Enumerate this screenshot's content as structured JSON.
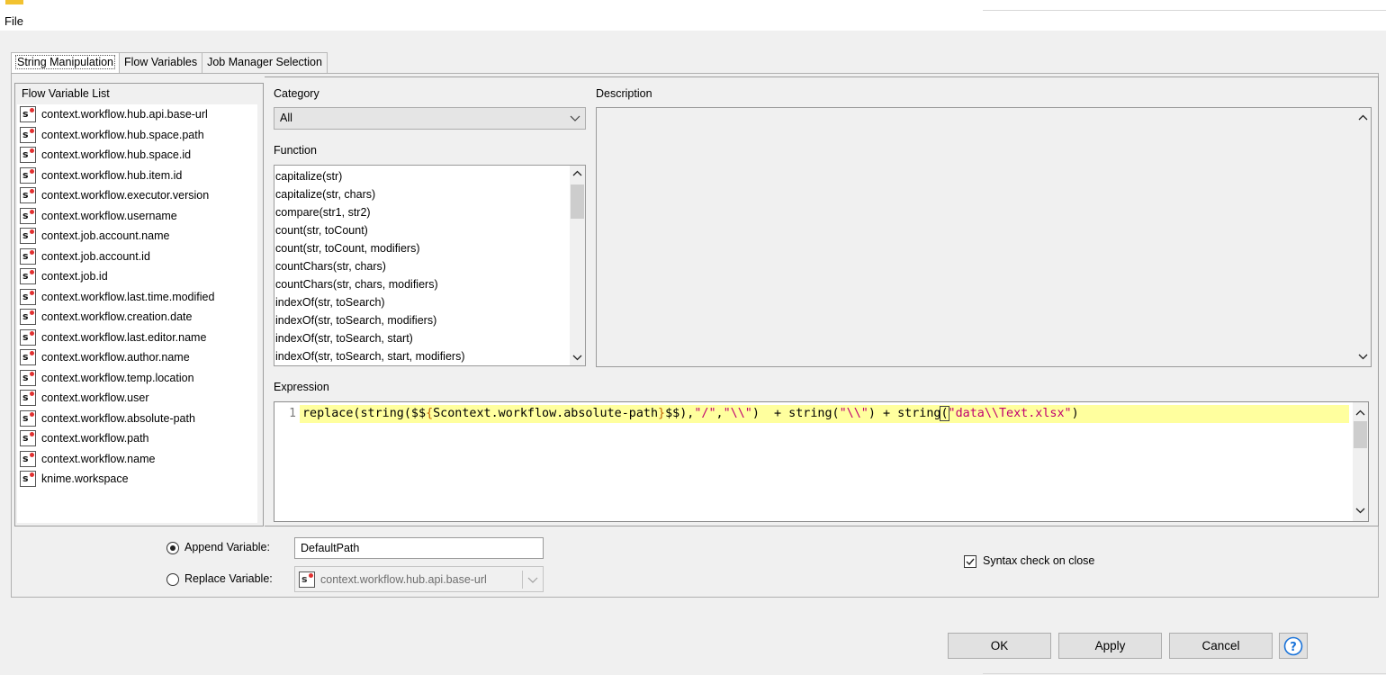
{
  "menu": {
    "file": "File"
  },
  "tabs": [
    {
      "label": "String Manipulation",
      "active": true
    },
    {
      "label": "Flow Variables",
      "active": false
    },
    {
      "label": "Job Manager Selection",
      "active": false
    }
  ],
  "flow_variables": {
    "title": "Flow Variable List",
    "type_badge": "s",
    "items": [
      "context.workflow.hub.api.base-url",
      "context.workflow.hub.space.path",
      "context.workflow.hub.space.id",
      "context.workflow.hub.item.id",
      "context.workflow.executor.version",
      "context.workflow.username",
      "context.job.account.name",
      "context.job.account.id",
      "context.job.id",
      "context.workflow.last.time.modified",
      "context.workflow.creation.date",
      "context.workflow.last.editor.name",
      "context.workflow.author.name",
      "context.workflow.temp.location",
      "context.workflow.user",
      "context.workflow.absolute-path",
      "context.workflow.path",
      "context.workflow.name",
      "knime.workspace"
    ]
  },
  "category": {
    "label": "Category",
    "value": "All"
  },
  "function": {
    "label": "Function",
    "items": [
      "capitalize(str)",
      "capitalize(str, chars)",
      "compare(str1, str2)",
      "count(str, toCount)",
      "count(str, toCount, modifiers)",
      "countChars(str, chars)",
      "countChars(str, chars, modifiers)",
      "indexOf(str, toSearch)",
      "indexOf(str, toSearch, modifiers)",
      "indexOf(str, toSearch, start)",
      "indexOf(str, toSearch, start, modifiers)"
    ]
  },
  "description": {
    "label": "Description"
  },
  "expression": {
    "label": "Expression",
    "line_number": "1",
    "tokens": [
      {
        "t": "replace(string($$",
        "k": "fn"
      },
      {
        "t": "{",
        "k": "brace"
      },
      {
        "t": "Scontext.workflow.absolute-path",
        "k": "var"
      },
      {
        "t": "}",
        "k": "brace"
      },
      {
        "t": "$$),",
        "k": "fn"
      },
      {
        "t": "\"/\"",
        "k": "str"
      },
      {
        "t": ",",
        "k": "fn"
      },
      {
        "t": "\"\\\\\"",
        "k": "str"
      },
      {
        "t": ")  + string(",
        "k": "fn"
      },
      {
        "t": "\"\\\\\"",
        "k": "str"
      },
      {
        "t": ") + string",
        "k": "fn"
      },
      {
        "t": "(",
        "k": "caret"
      },
      {
        "t": "\"data\\\\Text.xlsx\"",
        "k": "str"
      },
      {
        "t": ")",
        "k": "fn"
      }
    ]
  },
  "append_variable": {
    "label": "Append Variable:",
    "value": "DefaultPath",
    "selected": true
  },
  "replace_variable": {
    "label": "Replace Variable:",
    "value": "context.workflow.hub.api.base-url",
    "selected": false
  },
  "syntax_check": {
    "label": "Syntax check on close",
    "checked": true
  },
  "buttons": {
    "ok": "OK",
    "apply": "Apply",
    "cancel": "Cancel",
    "help": "?"
  },
  "colors": {
    "expression_highlight": "#ffff9e",
    "string_literal": "#c00070",
    "brace": "#c06000",
    "help_icon": "#1a73d9",
    "badge_dot": "#e03030"
  }
}
